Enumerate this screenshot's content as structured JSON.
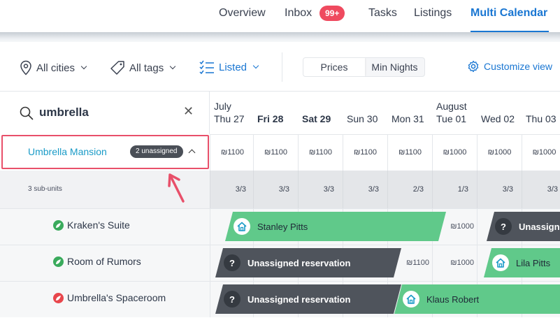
{
  "nav": {
    "items": [
      "Overview",
      "Inbox",
      "Tasks",
      "Listings",
      "Multi Calendar"
    ],
    "inbox_badge": "99+",
    "active": "Multi Calendar"
  },
  "filters": {
    "cities": "All cities",
    "tags": "All tags",
    "listed": "Listed",
    "toggle_prices": "Prices",
    "toggle_min_nights": "Min Nights",
    "customize": "Customize view"
  },
  "search": {
    "value": "umbrella",
    "clear_icon": "close-icon"
  },
  "listing": {
    "name": "Umbrella Mansion",
    "badge": "2 unassigned",
    "subunits": "3 sub-units",
    "units": [
      {
        "name": "Kraken's Suite",
        "icon_color": "#3aaa5c"
      },
      {
        "name": "Room of Rumors",
        "icon_color": "#3aaa5c"
      },
      {
        "name": "Umbrella's Spaceroom",
        "icon_color": "#e8464c"
      }
    ]
  },
  "calendar": {
    "days": [
      {
        "month": "July",
        "label": "Thu 27",
        "bold": false,
        "price": "₪1100",
        "avail": "3/3"
      },
      {
        "month": "",
        "label": "Fri 28",
        "bold": true,
        "price": "₪1100",
        "avail": "3/3"
      },
      {
        "month": "",
        "label": "Sat 29",
        "bold": true,
        "price": "₪1100",
        "avail": "3/3"
      },
      {
        "month": "",
        "label": "Sun 30",
        "bold": false,
        "price": "₪1100",
        "avail": "3/3"
      },
      {
        "month": "",
        "label": "Mon 31",
        "bold": false,
        "price": "₪1100",
        "avail": "2/3"
      },
      {
        "month": "August",
        "label": "Tue 01",
        "bold": false,
        "price": "₪1000",
        "avail": "1/3"
      },
      {
        "month": "",
        "label": "Wed 02",
        "bold": false,
        "price": "₪1000",
        "avail": "3/3"
      },
      {
        "month": "",
        "label": "Thu 03",
        "bold": false,
        "price": "₪1000",
        "avail": "3/3"
      }
    ],
    "free_cell_prices": {
      "kraken_tue01": "₪1000",
      "rumors_mon31": "₪1100",
      "rumors_tue01": "₪1000"
    },
    "reservations": [
      {
        "unit": 0,
        "guest": "Stanley Pitts",
        "type": "assigned"
      },
      {
        "unit": 0,
        "guest": "Unassigned reservation",
        "type": "unassigned"
      },
      {
        "unit": 1,
        "guest": "Unassigned reservation",
        "type": "unassigned"
      },
      {
        "unit": 1,
        "guest": "Lila Pitts",
        "type": "assigned"
      },
      {
        "unit": 2,
        "guest": "Unassigned reservation",
        "type": "unassigned"
      },
      {
        "unit": 2,
        "guest": "Klaus Robert",
        "type": "assigned"
      }
    ]
  },
  "colors": {
    "accent": "#1976d2",
    "listing_link": "#1a9bc7",
    "assigned": "#60c98a",
    "unassigned": "#4f545c",
    "highlight": "#e8506a"
  }
}
